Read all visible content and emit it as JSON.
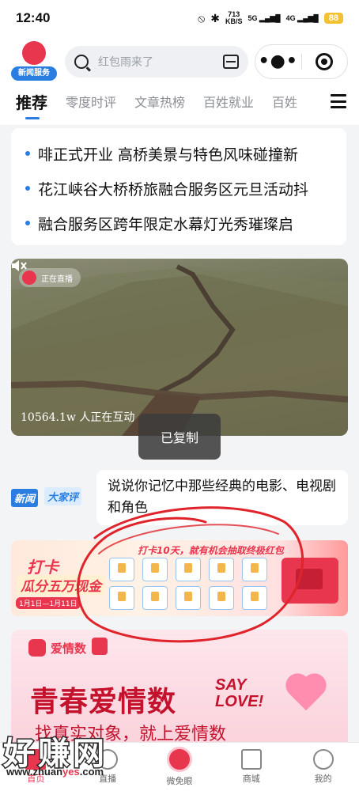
{
  "status_bar": {
    "time": "12:40",
    "net_speed": "713",
    "net_unit": "KB/S",
    "signal1": "5G",
    "signal2": "4G",
    "battery": "88"
  },
  "header": {
    "logo_text": "新闻服务",
    "search_placeholder": "红包雨来了",
    "more_label": "•●•"
  },
  "tabs": [
    {
      "label": "推荐"
    },
    {
      "label": "零度时评"
    },
    {
      "label": "文章热榜"
    },
    {
      "label": "百姓就业"
    },
    {
      "label": "百姓"
    }
  ],
  "news": [
    {
      "title": "啡正式开业  高桥美景与特色风味碰撞新"
    },
    {
      "title": "花江峡谷大桥桥旅融合服务区元旦活动抖"
    },
    {
      "title": "融合服务区跨年限定水幕灯光秀璀璨启"
    }
  ],
  "live": {
    "badge": "正在直播",
    "viewers": "10564.1w 人正在互动"
  },
  "toast": "已复制",
  "discuss": {
    "logo_part1": "新闻",
    "logo_part2": "大家评",
    "text": "说说你记忆中那些经典的电影、电视剧和角色"
  },
  "promo": {
    "title": "打卡10天，就有机会抽取终极红包",
    "left_line1": "打卡",
    "left_line2": "瓜分五万现金",
    "date": "1月1日—1月11日"
  },
  "love": {
    "brand": "爱情数",
    "title": "青春爱情数",
    "say": "SAY\nLOVE!",
    "subtitle": "找真实对象，就上爱情数"
  },
  "bottom_nav": [
    {
      "label": "首页"
    },
    {
      "label": "直播"
    },
    {
      "label": "微免眼"
    },
    {
      "label": "商城"
    },
    {
      "label": "我的"
    }
  ],
  "watermark": {
    "big": "好赚网",
    "url_prefix": "www.zhuan",
    "url_highlight": "yes",
    "url_suffix": ".com"
  },
  "colors": {
    "brand_red": "#e8364f",
    "accent_blue": "#2a7de1",
    "annotation_red": "#e0242c"
  }
}
